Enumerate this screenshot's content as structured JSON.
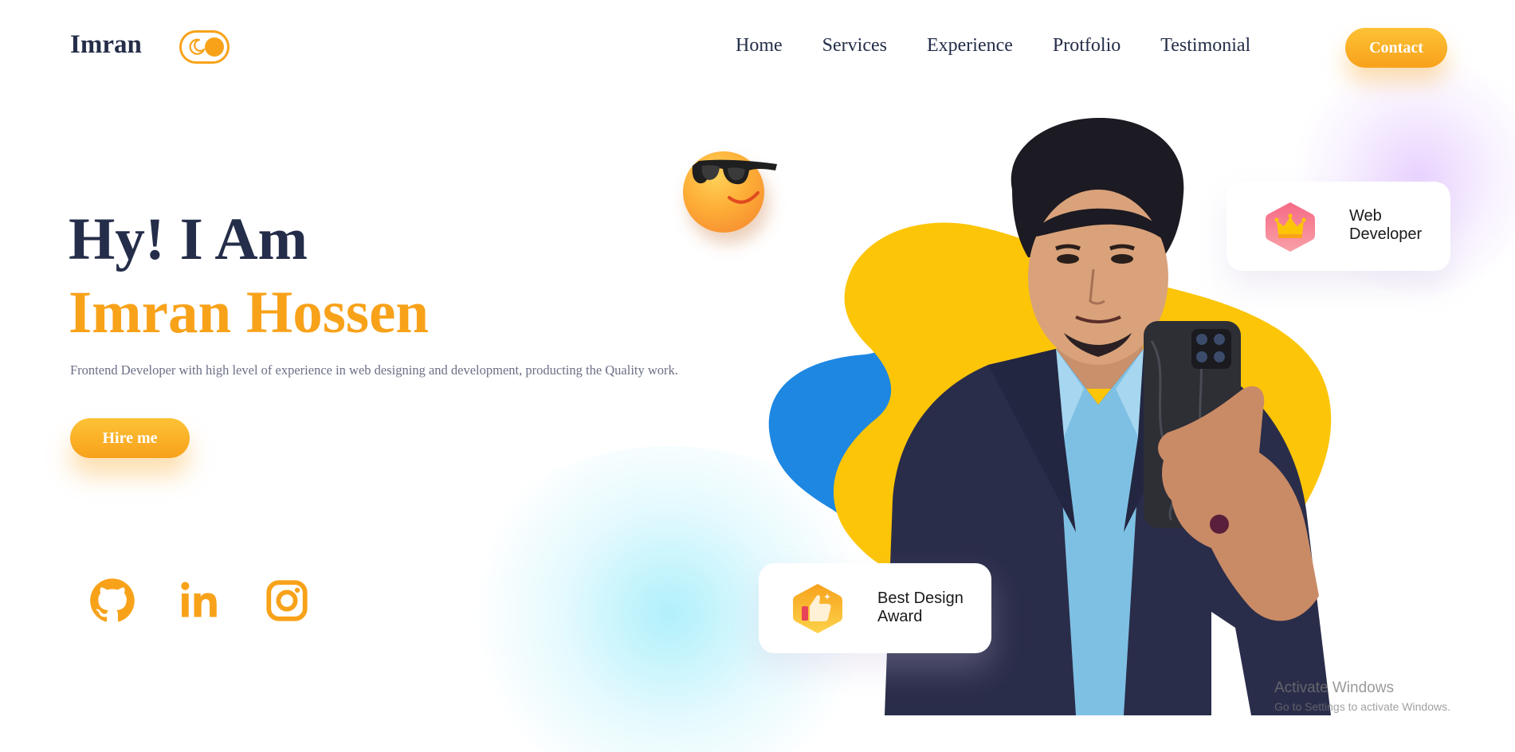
{
  "header": {
    "logo": "Imran",
    "theme_toggle": {
      "icons": [
        "moon-icon",
        "toggle-knob"
      ],
      "state": "light"
    },
    "nav": [
      "Home",
      "Services",
      "Experience",
      "Protfolio",
      "Testimonial"
    ],
    "contact_label": "Contact"
  },
  "hero": {
    "greeting": "Hy! I Am",
    "name": "Imran Hossen",
    "description": "Frontend Developer with high level of experience in web designing and development, producting the Quality work.",
    "hire_label": "Hire me",
    "social_icons": [
      "github-icon",
      "linkedin-icon",
      "instagram-icon"
    ]
  },
  "cards": {
    "web_developer": {
      "line1": "Web",
      "line2": "Developer",
      "icon": "crown-icon"
    },
    "award": {
      "line1": "Best Design",
      "line2": "Award",
      "icon": "thumbs-up-icon"
    }
  },
  "watermark": {
    "title": "Activate Windows",
    "subtitle": "Go to Settings to activate Windows."
  },
  "colors": {
    "accent": "#f8a21a",
    "dark_text": "#242d49",
    "blob_yellow": "#fcc508",
    "blob_blue": "#1d87e2"
  }
}
